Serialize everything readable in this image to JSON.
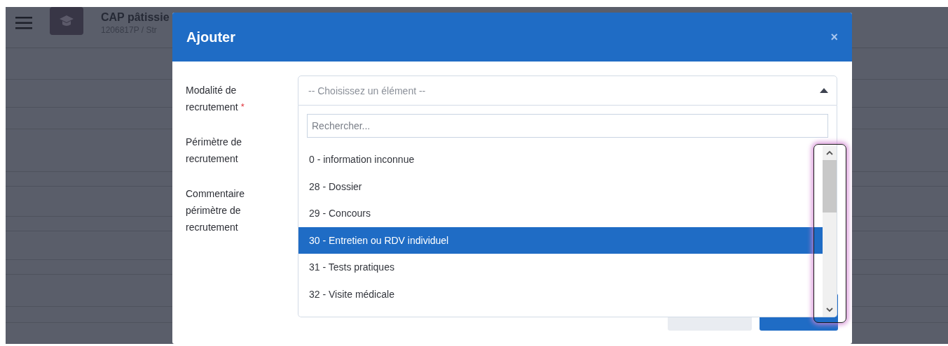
{
  "page": {
    "title": "CAP pâtissie",
    "subtitle": "1206817P / Str"
  },
  "dialog": {
    "title": "Ajouter",
    "close": "×",
    "fields": [
      {
        "label": "Modalité de recrutement",
        "required_mark": "*"
      },
      {
        "label": "Périmètre de recrutement"
      },
      {
        "label": "Commentaire périmètre de recrutement"
      }
    ],
    "select": {
      "placeholder": "-- Choisissez un élément --",
      "expanded": true,
      "search": {
        "placeholder": "Rechercher..."
      },
      "options": [
        {
          "label": "0 - information inconnue",
          "selected": false
        },
        {
          "label": "28 - Dossier",
          "selected": false
        },
        {
          "label": "29 - Concours",
          "selected": false
        },
        {
          "label": "30 - Entretien ou RDV individuel",
          "selected": true
        },
        {
          "label": "31 - Tests pratiques",
          "selected": false
        },
        {
          "label": "32 - Visite médicale",
          "selected": false
        }
      ]
    }
  }
}
